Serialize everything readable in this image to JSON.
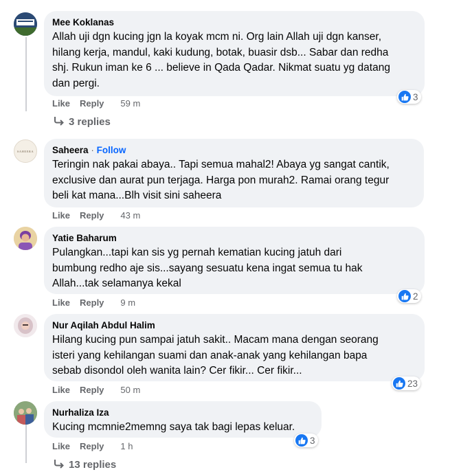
{
  "comments": [
    {
      "author": "Mee Koklanas",
      "text": "Allah uji dgn kucing jgn la koyak mcm ni. Org lain Allah uji dgn kanser,\nhilang kerja, mandul, kaki kudung, botak, buasir dsb... Sabar dan redha\nshj. Rukun iman ke 6 ... believe in Qada Qadar. Nikmat suatu yg datang\ndan pergi.",
      "like": "Like",
      "reply": "Reply",
      "time": "59 m",
      "reactions": "3"
    },
    {
      "author": "Saheera",
      "follow": "Follow",
      "text": "Teringin nak pakai abaya.. Tapi semua mahal2! Abaya yg sangat cantik,\nexclusive dan aurat pun terjaga. Harga pon murah2. Ramai orang tegur\nbeli kat mana...Blh visit sini saheera",
      "like": "Like",
      "reply": "Reply",
      "time": "43 m",
      "avatar_text": "SAHEERA"
    },
    {
      "author": "Yatie Baharum",
      "text": "Pulangkan...tapi kan sis yg pernah kematian kucing jatuh dari\nbumbung redho aje sis...sayang sesuatu kena ingat semua tu hak\nAllah...tak selamanya kekal",
      "like": "Like",
      "reply": "Reply",
      "time": "9 m",
      "reactions": "2"
    },
    {
      "author": "Nur Aqilah Abdul Halim",
      "text": "Hilang kucing pun sampai jatuh sakit.. Macam mana dengan seorang\nisteri yang kehilangan suami dan anak-anak yang kehilangan bapa\nsebab disondol oleh wanita lain? Cer fikir... Cer fikir...",
      "like": "Like",
      "reply": "Reply",
      "time": "50 m",
      "reactions": "23"
    },
    {
      "author": "Nurhaliza Iza",
      "text": "Kucing mcmnie2memng saya tak bagi lepas keluar.",
      "like": "Like",
      "reply": "Reply",
      "time": "1 h",
      "reactions": "3"
    }
  ],
  "replies": [
    {
      "label": "3 replies"
    },
    {
      "label": "13 replies"
    }
  ],
  "separator": "·",
  "colors": {
    "bubble": "#f0f2f5",
    "like_blue": "#1877f2",
    "meta": "#65676b",
    "follow": "#0866ff"
  },
  "icons": [
    "like-thumb-icon",
    "reply-arrow-icon"
  ]
}
